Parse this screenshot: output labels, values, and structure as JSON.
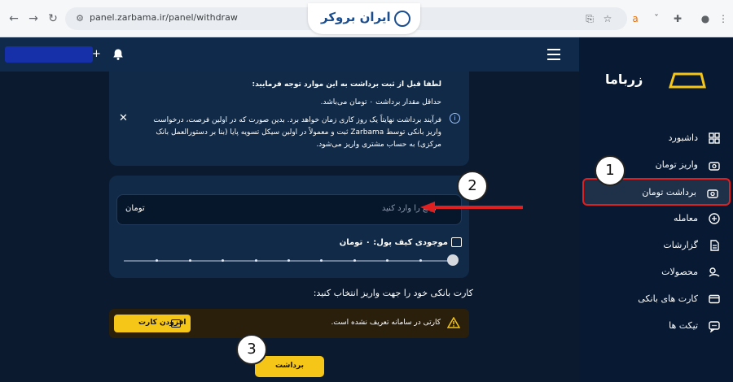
{
  "browser": {
    "url": "panel.zarbama.ir/panel/withdraw",
    "logo_text": "ایران بروکر"
  },
  "sidebar": {
    "brand": "زرباما",
    "items": [
      {
        "label": "داشبورد",
        "icon": "dashboard-icon"
      },
      {
        "label": "واریز تومان",
        "icon": "deposit-icon"
      },
      {
        "label": "برداشت تومان",
        "icon": "withdraw-icon",
        "active": true
      },
      {
        "label": "معامله",
        "icon": "trade-icon"
      },
      {
        "label": "گزارشات",
        "icon": "report-icon"
      },
      {
        "label": "محصولات",
        "icon": "products-icon"
      },
      {
        "label": "کارت های بانکی",
        "icon": "card-icon"
      },
      {
        "label": "تیکت ها",
        "icon": "ticket-icon"
      }
    ]
  },
  "appbar": {
    "plus": "+"
  },
  "info": {
    "heading": "لطفا قبل از ثبت برداشت به این موارد توجه فرمایید:",
    "line1": "حداقل مقدار برداشت ۰ تومان می‌باشد.",
    "line2a": "فرآیند برداشت نهایتاً یک روز کاری زمان خواهد برد. بدین صورت که در اولین فرصت، درخواست",
    "line2b": "واریز بانکی توسط Zarbama ثبت و معمولاً در اولین سیکل تسویه پایا (بنا بر دستورالعمل بانک",
    "line2c": "مرکزی) به حساب مشتری واریز می‌شود."
  },
  "amount": {
    "placeholder": "مبلغ را وارد کنید",
    "unit": "تومان",
    "wallet": "موجودی کیف پول: ۰ تومان",
    "slider_value_fraction": 1.0
  },
  "bank": {
    "title": "کارت بانکی خود را جهت واریز انتخاب کنید:",
    "empty_msg": "کارتی در سامانه تعریف نشده است.",
    "add_label": "افزودن کارت"
  },
  "submit_label": "برداشت",
  "annotations": {
    "badge1": "1",
    "badge2": "2",
    "badge3": "3"
  },
  "colors": {
    "accent": "#f5c518",
    "highlight": "#e02020",
    "sidebar_bg": "#081a33"
  }
}
